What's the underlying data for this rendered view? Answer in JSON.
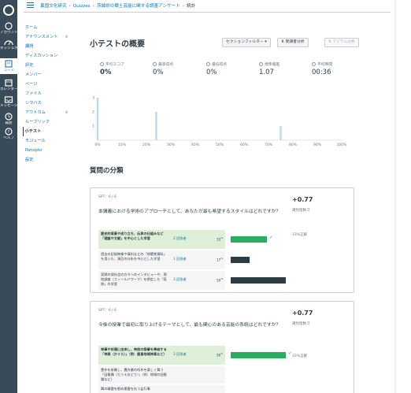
{
  "global_nav": {
    "items": [
      {
        "label": "アカウント"
      },
      {
        "label": "ダッシュボード"
      },
      {
        "label": "コース"
      },
      {
        "label": "カレンダー"
      },
      {
        "label": "メッセージ"
      },
      {
        "label": "履歴"
      },
      {
        "label": "ヘルプ"
      }
    ]
  },
  "breadcrumb": [
    "異国文化研究",
    "Quizzes",
    "茨城県の郷土芸能に関する調査アンケート",
    "統計"
  ],
  "course_nav": {
    "items": [
      {
        "label": "ホーム",
        "hidden": false
      },
      {
        "label": "アナウンスメント",
        "hidden": true
      },
      {
        "label": "課題",
        "hidden": false
      },
      {
        "label": "ディスカッション",
        "hidden": false
      },
      {
        "label": "評定",
        "hidden": false
      },
      {
        "label": "メンバー",
        "hidden": false
      },
      {
        "label": "ページ",
        "hidden": false
      },
      {
        "label": "ファイル",
        "hidden": false
      },
      {
        "label": "シラバス",
        "hidden": false
      },
      {
        "label": "アウトカム",
        "hidden": true
      },
      {
        "label": "ルーブリック",
        "hidden": false
      },
      {
        "label": "小テスト",
        "hidden": false,
        "active": true
      },
      {
        "label": "モジュール",
        "hidden": false
      },
      {
        "label": "Panopto",
        "hidden": false
      },
      {
        "label": "設定",
        "hidden": false
      }
    ]
  },
  "page": {
    "title": "小テストの概要",
    "buttons": {
      "section_filter": "セクションフィルター ▾",
      "student_analysis": "受講者分析",
      "item_analysis": "アイテム分析"
    },
    "stats": [
      {
        "label": "平均スコア",
        "value": "0%"
      },
      {
        "label": "最高得点",
        "value": "0%"
      },
      {
        "label": "最低得点",
        "value": "0%"
      },
      {
        "label": "標準偏差",
        "value": "1.07"
      },
      {
        "label": "平均時間",
        "value": "00:36"
      }
    ]
  },
  "chart_data": {
    "type": "bar",
    "categories": [
      "0%",
      "10%",
      "20%",
      "30%",
      "40%",
      "50%",
      "60%",
      "70%",
      "80%",
      "90%",
      "100%"
    ],
    "y_ticks": [
      "1",
      "2",
      "3"
    ],
    "ylim": [
      0,
      3
    ],
    "bars": [
      {
        "x": 0,
        "value": 3
      },
      {
        "x": 24,
        "value": 2
      },
      {
        "x": 75,
        "value": 1
      }
    ],
    "bar_color": "#b9dcef"
  },
  "section": {
    "title": "質問の分類"
  },
  "questions": [
    {
      "points": "SPT：6 / 6",
      "text": "本講義における学術のアプローチとして、あなたが最も希望するスタイルはどれですか？",
      "discrimination": "+0.77",
      "discrimination_label": "識別指数",
      "correct_rate": "33%正解",
      "answers": [
        {
          "text": "歴史的背景や成り立ち、伝承の仕組みなど「理論や文献」を中心とした学習",
          "count": "2 回答者",
          "pct": "33",
          "correct": true,
          "fraction": 0.33
        },
        {
          "text": "過去の記録映像や資料などの「視聴覚資料」を用いた、演目の分析を中心とした学習",
          "count": "1 回答者",
          "pct": "17",
          "correct": false,
          "fraction": 0.17
        },
        {
          "text": "実際の保存会の方々へのインタビューや、現地調査（フィールドワーク）を想定した「実践」の学習",
          "count": "3 回答者",
          "pct": "50",
          "correct": false,
          "fraction": 0.5
        }
      ]
    },
    {
      "points": "SPT：6 / 6",
      "text": "今後の授業で最初に取り上げるテーマとして、最も関心のある芸能の系統はどれですか？",
      "discrimination": "+0.77",
      "discrimination_label": "識別指数",
      "correct_rate": "33%正解",
      "answers": [
        {
          "text": "神事や祈禱に由来し、神前の祭事を奉納する「神楽（かぐら）」（例：鹿島地域神楽など）",
          "count": "3 回答者",
          "pct": "50",
          "correct": true,
          "fraction": 0.5
        },
        {
          "text": "豊作を祈願し、農作業の所作を楽しく舞う「田植踊（たうえおどり）」（例：地域の田植踊など）",
          "count": "",
          "pct": "",
          "correct": false,
          "fraction": 0
        },
        {
          "text": "舞の精霊を慰め悪霊を払う盆行事",
          "count": "",
          "pct": "",
          "correct": false,
          "fraction": 0
        }
      ]
    }
  ]
}
